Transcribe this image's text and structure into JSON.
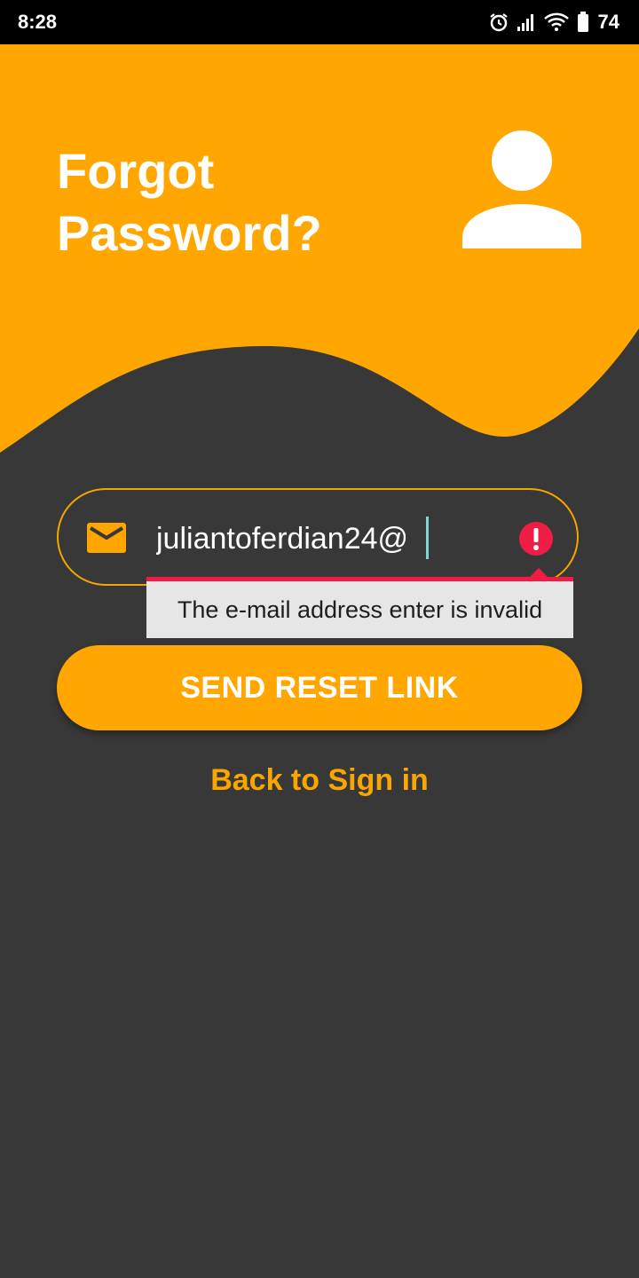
{
  "status_bar": {
    "time": "8:28",
    "battery_level": "74",
    "icons": [
      "alarm-icon",
      "signal-icon",
      "wifi-icon",
      "battery-icon"
    ]
  },
  "header": {
    "title_line1": "Forgot",
    "title_line2": "Password?",
    "icon": "user-avatar-icon"
  },
  "form": {
    "email_value": "juliantoferdian24@",
    "email_icon": "mail-icon",
    "error_icon": "error-icon",
    "error_message": "The e-mail address enter is invalid",
    "submit_label": "SEND RESET LINK",
    "back_link_label": "Back to Sign in"
  },
  "colors": {
    "accent": "#ffa600",
    "background": "#383838",
    "error": "#ef1c45",
    "tooltip_bg": "#e6e6e6"
  }
}
